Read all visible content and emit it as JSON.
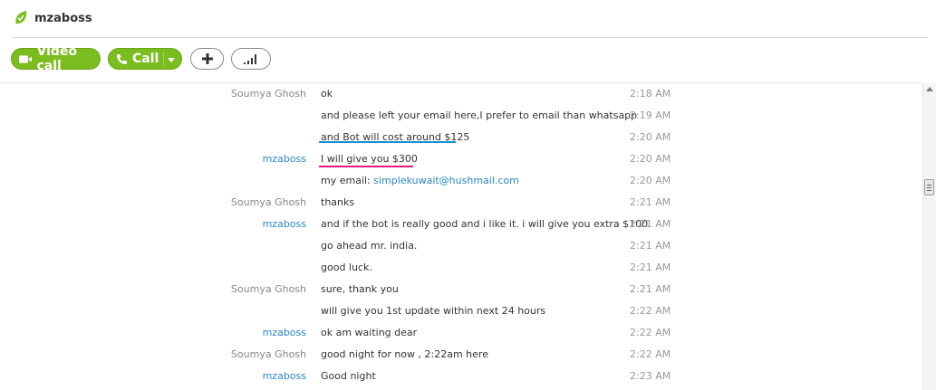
{
  "header": {
    "contact_name": "mzaboss",
    "status_icon": "online-leaf-icon",
    "status_color": "#7bbd1e"
  },
  "toolbar": {
    "video_call_label": "Video call",
    "call_label": "Call",
    "add_icon": "plus-icon",
    "signal_icon": "signal-bars-icon",
    "button_color": "#7bbd1e"
  },
  "messages": [
    {
      "sender": "Soumya Ghosh",
      "text": "ok",
      "time": "2:18 AM"
    },
    {
      "sender": "",
      "text": "and please left your email here,I prefer to email than whatsapp",
      "time": "2:19 AM"
    },
    {
      "sender": "",
      "text": "and Bot will cost around $125",
      "time": "2:20 AM"
    },
    {
      "sender": "mzaboss",
      "text": "I will give you $300",
      "time": "2:20 AM"
    },
    {
      "sender": "",
      "text_prefix": "my email: ",
      "link": "simplekuwait@hushmail.com",
      "time": "2:20 AM"
    },
    {
      "sender": "Soumya Ghosh",
      "text": "thanks",
      "time": "2:21 AM"
    },
    {
      "sender": "mzaboss",
      "text": "and if the bot is really good and i like it. i will give you extra $100",
      "time": "2:21 AM"
    },
    {
      "sender": "",
      "text": "go ahead mr. india.",
      "time": "2:21 AM"
    },
    {
      "sender": "",
      "text": "good luck.",
      "time": "2:21 AM"
    },
    {
      "sender": "Soumya Ghosh",
      "text": "sure, thank you",
      "time": "2:21 AM"
    },
    {
      "sender": "",
      "text": "will give you 1st update within next 24 hours",
      "time": "2:22 AM"
    },
    {
      "sender": "mzaboss",
      "text": "ok am waiting dear",
      "time": "2:22 AM"
    },
    {
      "sender": "Soumya Ghosh",
      "text": "good night for now , 2:22am here",
      "time": "2:22 AM"
    },
    {
      "sender": "mzaboss",
      "text": "Good night",
      "time": "2:23 AM"
    }
  ],
  "annotations": {
    "blue_underline_color": "#1a8fd6",
    "pink_underline_color": "#e0187f"
  }
}
